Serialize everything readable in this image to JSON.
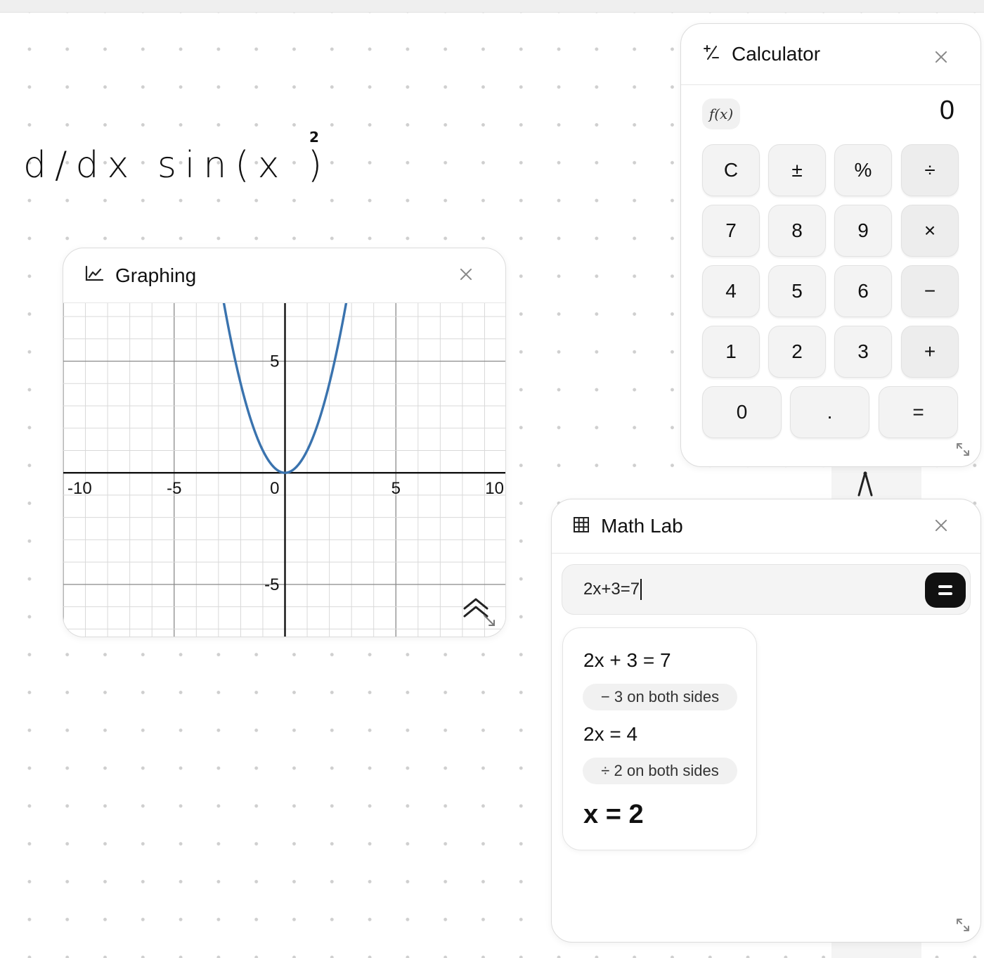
{
  "canvas": {
    "handwriting": "d/dx sin(x )",
    "handwriting_superscript": "2"
  },
  "graphing": {
    "title": "Graphing",
    "icon": "line-chart-icon",
    "close_icon": "close-icon",
    "collapse_icon": "double-chevron-up-icon",
    "resize_icon": "resize-icon",
    "curve_color": "#3a73ae"
  },
  "chart_data": {
    "type": "line",
    "title": "",
    "xlabel": "",
    "ylabel": "",
    "xlim": [
      -10,
      10
    ],
    "ylim": [
      -7.4,
      7.6
    ],
    "x_ticks": [
      "-10",
      "-5",
      "0",
      "5",
      "10"
    ],
    "y_ticks": [
      "5",
      "-5"
    ],
    "grid": true,
    "series": [
      {
        "function": "y = x^2",
        "color": "#3a73ae"
      }
    ]
  },
  "calculator": {
    "title": "Calculator",
    "icon": "plus-minus-icon",
    "fx_label": "f(x)",
    "display": "0",
    "keys": [
      [
        "C",
        "±",
        "%",
        "÷"
      ],
      [
        "7",
        "8",
        "9",
        "×"
      ],
      [
        "4",
        "5",
        "6",
        "−"
      ],
      [
        "1",
        "2",
        "3",
        "+"
      ],
      [
        "0",
        ".",
        "="
      ]
    ]
  },
  "mathlab": {
    "title": "Math Lab",
    "icon": "grid-icon",
    "input_value": "2x+3=7",
    "steps": {
      "eq1": "2x + 3 = 7",
      "note1": "− 3 on both sides",
      "eq2": "2x = 4",
      "note2": "÷ 2 on both sides",
      "result": "x = 2"
    }
  }
}
